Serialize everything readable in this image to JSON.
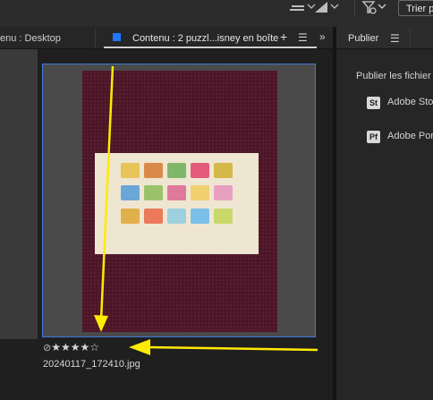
{
  "toolbar": {
    "sort_label": "Trier p",
    "icons": [
      "stack-icon",
      "quality-icon",
      "filter-icon"
    ]
  },
  "tabs": {
    "desktop_label": "enu : Desktop",
    "content_label": "Contenu : 2 puzzl...isney en boîte",
    "plus": "+",
    "menu": "☰",
    "collapse": "»"
  },
  "thumbnail": {
    "rating": 4,
    "max_rating": 5,
    "filename": "20240117_172410.jpg"
  },
  "publish_panel": {
    "tab_label": "Publier",
    "menu": "☰",
    "heading": "Publier les fichier",
    "services": [
      {
        "badge": "St",
        "label": "Adobe Sto"
      },
      {
        "badge": "Pf",
        "label": "Adobe Por"
      }
    ]
  },
  "colors": {
    "accent": "#1f77ff",
    "selection_border": "#3e7bd6",
    "annotation_arrow": "#ffeb00"
  }
}
